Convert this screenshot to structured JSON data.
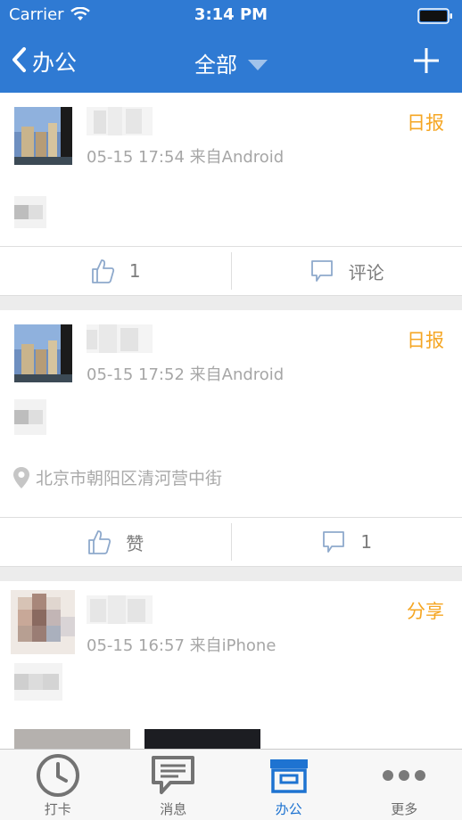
{
  "status_bar": {
    "carrier": "Carrier",
    "time": "3:14 PM"
  },
  "nav": {
    "back_label": "办公",
    "title": "全部"
  },
  "posts": [
    {
      "time": "05-15 17:54",
      "source": "来自Android",
      "tag": "日报",
      "like_label": "1",
      "comment_label": "评论",
      "location": ""
    },
    {
      "time": "05-15 17:52",
      "source": "来自Android",
      "tag": "日报",
      "like_label": "赞",
      "comment_label": "1",
      "location": "北京市朝阳区清河营中街"
    },
    {
      "time": "05-15 16:57",
      "source": "来自iPhone",
      "tag": "分享",
      "like_label": "",
      "comment_label": "",
      "location": ""
    }
  ],
  "tabbar": {
    "items": [
      {
        "label": "打卡",
        "icon": "clock-icon"
      },
      {
        "label": "消息",
        "icon": "message-icon"
      },
      {
        "label": "办公",
        "icon": "office-icon"
      },
      {
        "label": "更多",
        "icon": "more-icon"
      }
    ],
    "active_index": 2
  },
  "colors": {
    "brand_blue": "#2f7ad3",
    "tag_orange": "#f5a623",
    "active_tab": "#1e73d1"
  }
}
